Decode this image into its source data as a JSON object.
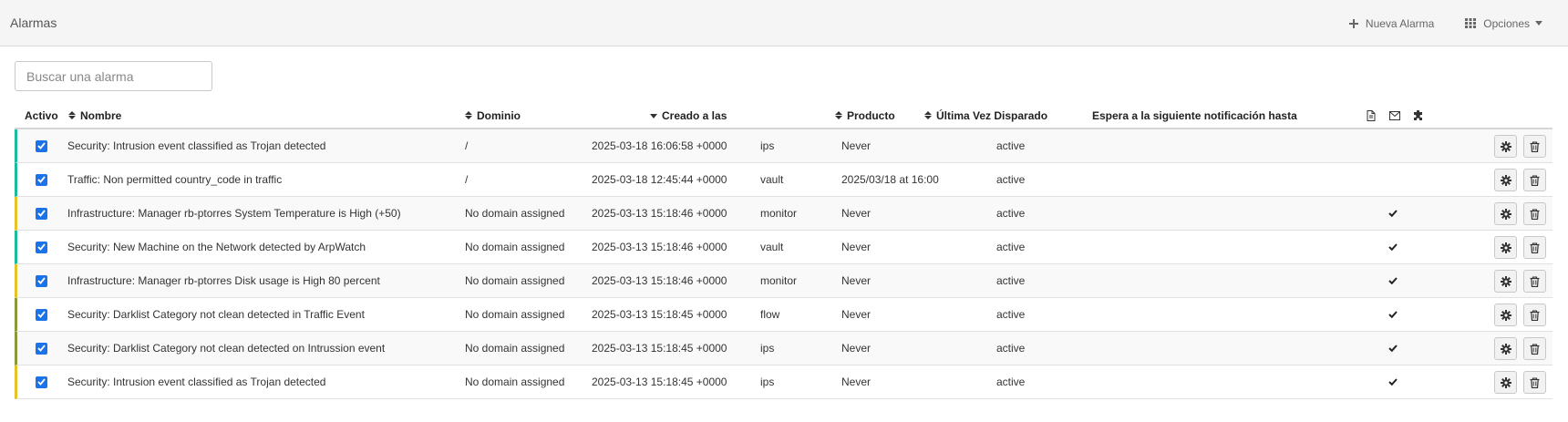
{
  "header": {
    "title": "Alarmas",
    "new_alarm_label": "Nueva Alarma",
    "options_label": "Opciones"
  },
  "search": {
    "placeholder": "Buscar una alarma",
    "value": ""
  },
  "columns": {
    "active": "Activo",
    "name": "Nombre",
    "domain": "Dominio",
    "created": "Creado a las",
    "product": "Producto",
    "last_triggered": "Última Vez Disparado",
    "wait_until": "Espera a la siguiente notificación hasta"
  },
  "header_icons": [
    "document-icon",
    "envelope-icon",
    "puzzle-icon"
  ],
  "colors": {
    "teal": "#1abc9c",
    "yellow": "#e6c229",
    "olive": "#8a9a3b",
    "checkbox": "#1a73e8"
  },
  "rows": [
    {
      "active": true,
      "name": "Security: Intrusion event classified as Trojan detected",
      "domain": "/",
      "created": "2025-03-18 16:06:58 +0000",
      "product": "ips",
      "last_triggered": "Never",
      "wait_until": "active",
      "email": false,
      "accent": "#1abc9c"
    },
    {
      "active": true,
      "name": "Traffic: Non permitted country_code in traffic",
      "domain": "/",
      "created": "2025-03-18 12:45:44 +0000",
      "product": "vault",
      "last_triggered": "2025/03/18 at 16:00",
      "wait_until": "active",
      "email": false,
      "accent": "#1abc9c"
    },
    {
      "active": true,
      "name": "Infrastructure: Manager rb-ptorres System Temperature is High (+50)",
      "domain": "No domain assigned",
      "created": "2025-03-13 15:18:46 +0000",
      "product": "monitor",
      "last_triggered": "Never",
      "wait_until": "active",
      "email": true,
      "accent": "#e6c229"
    },
    {
      "active": true,
      "name": "Security: New Machine on the Network detected by ArpWatch",
      "domain": "No domain assigned",
      "created": "2025-03-13 15:18:46 +0000",
      "product": "vault",
      "last_triggered": "Never",
      "wait_until": "active",
      "email": true,
      "accent": "#1abc9c"
    },
    {
      "active": true,
      "name": "Infrastructure: Manager rb-ptorres Disk usage is High 80 percent",
      "domain": "No domain assigned",
      "created": "2025-03-13 15:18:46 +0000",
      "product": "monitor",
      "last_triggered": "Never",
      "wait_until": "active",
      "email": true,
      "accent": "#e6c229"
    },
    {
      "active": true,
      "name": "Security: Darklist Category not clean detected in Traffic Event",
      "domain": "No domain assigned",
      "created": "2025-03-13 15:18:45 +0000",
      "product": "flow",
      "last_triggered": "Never",
      "wait_until": "active",
      "email": true,
      "accent": "#8a9a3b"
    },
    {
      "active": true,
      "name": "Security: Darklist Category not clean detected on Intrussion event",
      "domain": "No domain assigned",
      "created": "2025-03-13 15:18:45 +0000",
      "product": "ips",
      "last_triggered": "Never",
      "wait_until": "active",
      "email": true,
      "accent": "#8a9a3b"
    },
    {
      "active": true,
      "name": "Security: Intrusion event classified as Trojan detected",
      "domain": "No domain assigned",
      "created": "2025-03-13 15:18:45 +0000",
      "product": "ips",
      "last_triggered": "Never",
      "wait_until": "active",
      "email": true,
      "accent": "#e6c229"
    }
  ]
}
